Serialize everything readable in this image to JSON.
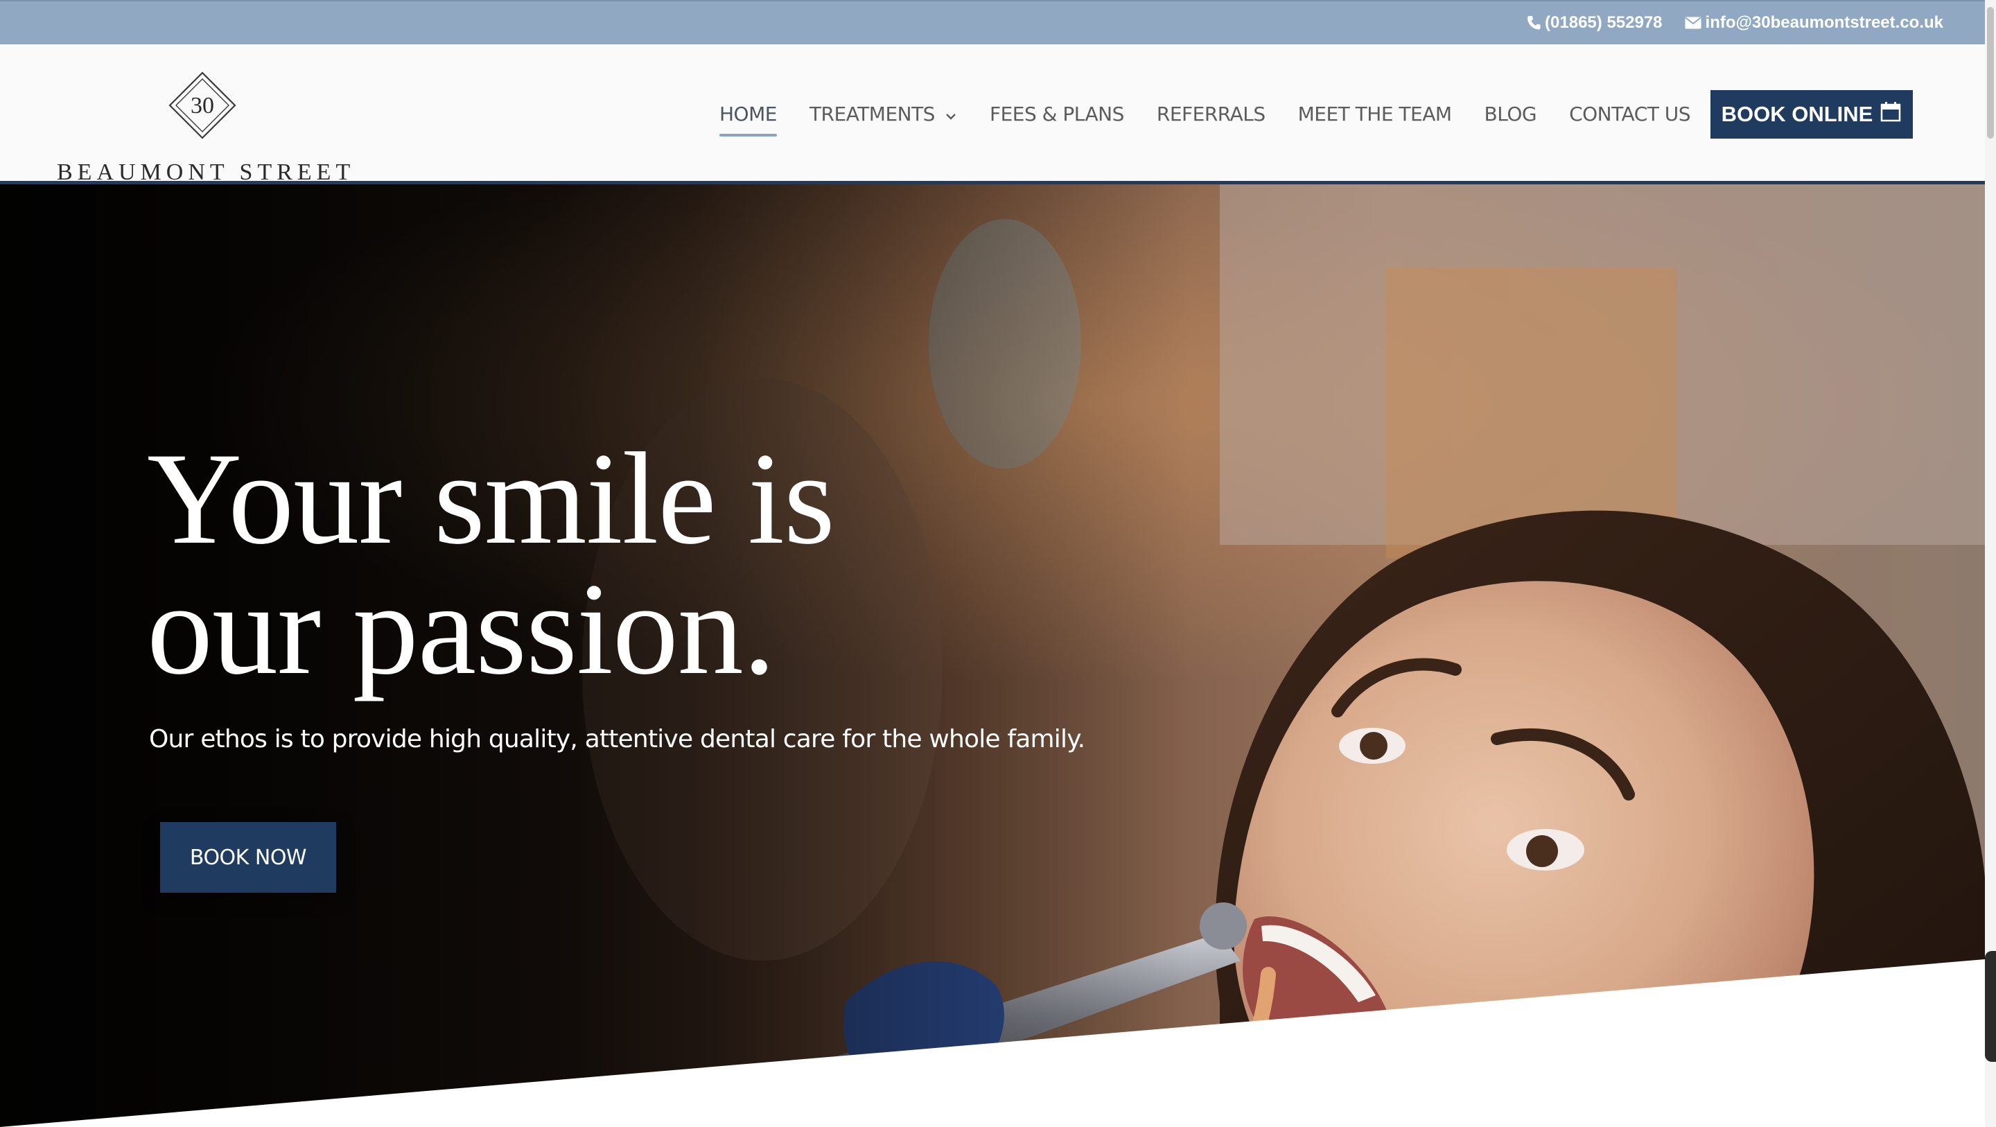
{
  "topbar": {
    "phone": "(01865) 552978",
    "email": "info@30beaumontstreet.co.uk",
    "phone_icon": "phone-icon",
    "email_icon": "envelope-icon",
    "background_color": "#90a8c2"
  },
  "header": {
    "logo": {
      "mark": "30",
      "name": "BEAUMONT STREET"
    },
    "nav": [
      {
        "label": "HOME",
        "active": true
      },
      {
        "label": "TREATMENTS",
        "has_dropdown": true
      },
      {
        "label": "FEES & PLANS"
      },
      {
        "label": "REFERRALS"
      },
      {
        "label": "MEET THE TEAM"
      },
      {
        "label": "BLOG"
      },
      {
        "label": "CONTACT US"
      }
    ],
    "book_online": {
      "label": "BOOK ONLINE",
      "icon": "calendar-icon"
    },
    "accent_color": "#1f3b60"
  },
  "hero": {
    "heading_line1": "Your smile is",
    "heading_line2": "our passion.",
    "subheading": "Our ethos is to provide high quality, attentive dental care for the whole family.",
    "cta_label": "BOOK NOW"
  }
}
